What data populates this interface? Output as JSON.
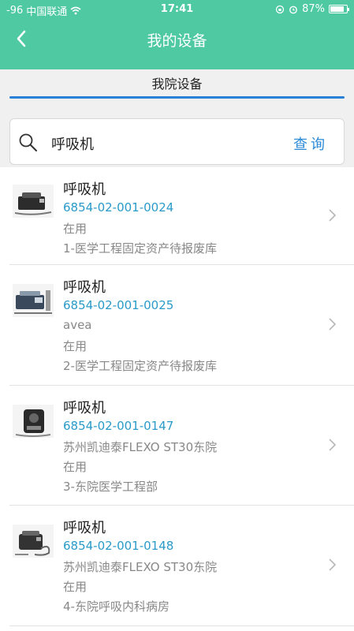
{
  "status_bar": {
    "signal": "-96",
    "carrier": "中国联通",
    "time": "17:41",
    "battery": "87%"
  },
  "nav": {
    "title": "我的设备"
  },
  "tab": {
    "label": "我院设备"
  },
  "search": {
    "value": "呼吸机",
    "button": "查询"
  },
  "devices": [
    {
      "name": "呼吸机",
      "code": "6854-02-001-0024",
      "details": [
        "在用",
        "1-医学工程固定资产待报废库"
      ]
    },
    {
      "name": "呼吸机",
      "code": "6854-02-001-0025",
      "details": [
        "avea",
        "在用",
        "2-医学工程固定资产待报废库"
      ]
    },
    {
      "name": "呼吸机",
      "code": "6854-02-001-0147",
      "details": [
        "苏州凯迪泰FLEXO ST30东院",
        "在用",
        "3-东院医学工程部"
      ]
    },
    {
      "name": "呼吸机",
      "code": "6854-02-001-0148",
      "details": [
        "苏州凯迪泰FLEXO ST30东院",
        "在用",
        "4-东院呼吸内科病房"
      ]
    }
  ],
  "colors": {
    "header": "#4ec9a2",
    "accent": "#2a7fd6",
    "code": "#2a9ac9"
  }
}
